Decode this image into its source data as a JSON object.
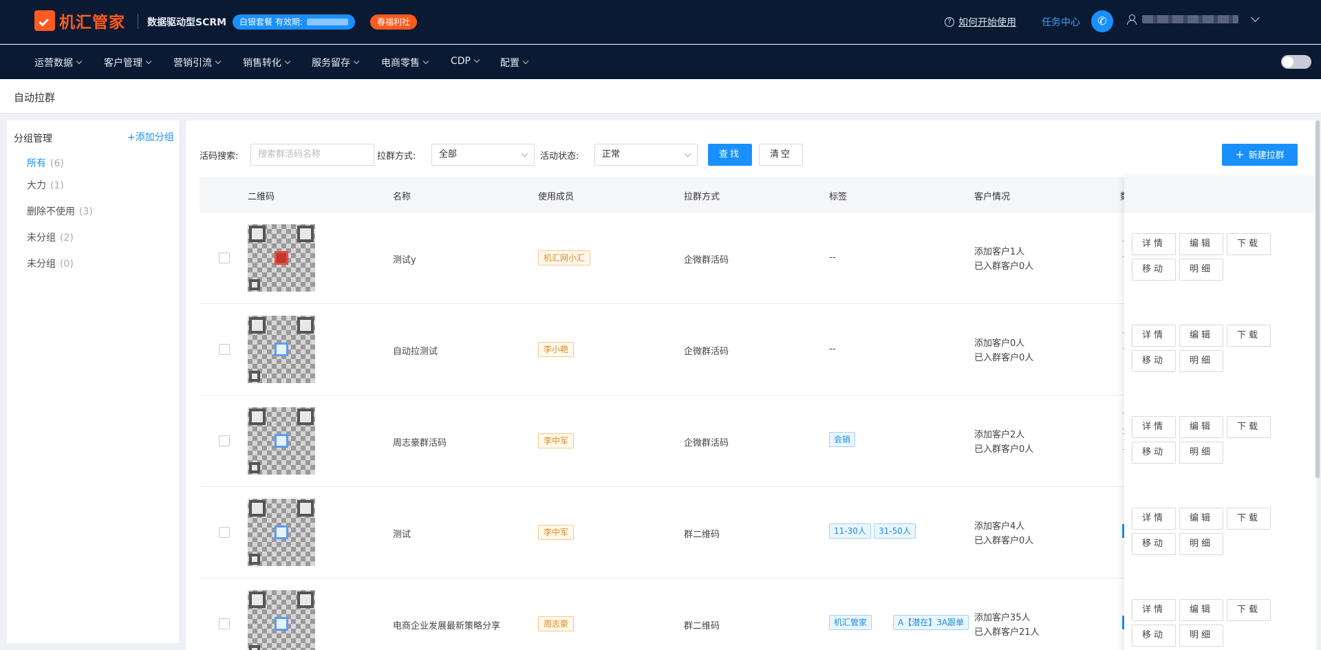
{
  "header": {
    "logo_text": "机汇管家",
    "subtitle": "数据驱动型SCRM",
    "plan_label": "白银套餐 有效期:",
    "welfare_label": "春福利社",
    "help_text": "如何开始使用",
    "task_center": "任务中心"
  },
  "nav": [
    {
      "label": "运营数据"
    },
    {
      "label": "客户管理"
    },
    {
      "label": "营销引流"
    },
    {
      "label": "销售转化"
    },
    {
      "label": "服务留存"
    },
    {
      "label": "电商零售"
    },
    {
      "label": "CDP"
    },
    {
      "label": "配置"
    }
  ],
  "breadcrumb": "自动拉群",
  "groups": {
    "title": "分组管理",
    "add_label": "+添加分组",
    "items": [
      {
        "name": "所有",
        "count": "(6)"
      },
      {
        "name": "大力",
        "count": "(1)"
      },
      {
        "name": "删除不使用",
        "count": "(3)"
      },
      {
        "name": "未分组",
        "count": "(2)"
      },
      {
        "name": "未分组",
        "count": "(0)"
      }
    ]
  },
  "filters": {
    "search_label": "活码搜索:",
    "search_placeholder": "搜索群活码名称",
    "method_label": "拉群方式:",
    "method_value": "全部",
    "status_label": "活动状态:",
    "status_value": "正常",
    "search_btn": "查找",
    "clear_btn": "清空",
    "new_btn": "新建拉群"
  },
  "table": {
    "columns": [
      "二维码",
      "名称",
      "使用成员",
      "拉群方式",
      "标签",
      "客户情况",
      "数"
    ],
    "rows": [
      {
        "name": "测试y",
        "member": "机汇网小汇",
        "method": "企微群活码",
        "tags": [],
        "no_tag": "--",
        "added": "添加客户1人",
        "joined": "已入群客户0人"
      },
      {
        "name": "自动拉测试",
        "member": "李小艳",
        "method": "企微群活码",
        "tags": [],
        "no_tag": "--",
        "added": "添加客户0人",
        "joined": "已入群客户0人"
      },
      {
        "name": "周志豪群活码",
        "member": "李中军",
        "method": "企微群活码",
        "tags": [
          "会销"
        ],
        "no_tag": "",
        "added": "添加客户2人",
        "joined": "已入群客户0人"
      },
      {
        "name": "测试",
        "member": "李中军",
        "method": "群二维码",
        "tags": [
          "11-30人",
          "31-50人"
        ],
        "no_tag": "",
        "added": "添加客户4人",
        "joined": "已入群客户0人"
      },
      {
        "name": "电商企业发展最新策略分享",
        "member": "周志豪",
        "method": "群二维码",
        "tags": [
          "机汇管家",
          "A【潜在】3A跟单"
        ],
        "no_tag": "",
        "added": "添加客户35人",
        "joined": "已入群客户21人"
      }
    ]
  },
  "actions": {
    "detail": "详情",
    "edit": "编辑",
    "download": "下载",
    "move": "移动",
    "breakdown": "明细"
  }
}
